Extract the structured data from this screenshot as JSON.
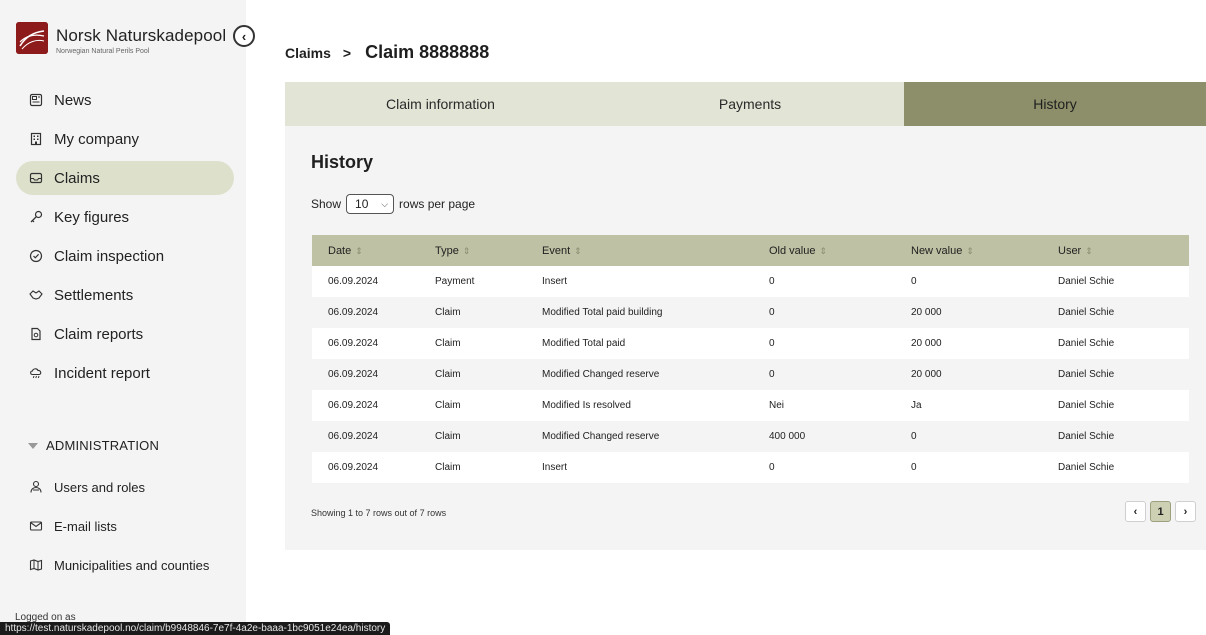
{
  "brand": {
    "title": "Norsk Naturskadepool",
    "subtitle": "Norwegian Natural Perils Pool"
  },
  "sidebar": {
    "items": [
      {
        "label": "News",
        "icon": "newspaper-icon"
      },
      {
        "label": "My company",
        "icon": "building-icon"
      },
      {
        "label": "Claims",
        "icon": "inbox-icon",
        "active": true
      },
      {
        "label": "Key figures",
        "icon": "key-icon"
      },
      {
        "label": "Claim inspection",
        "icon": "check-circle-icon"
      },
      {
        "label": "Settlements",
        "icon": "handshake-icon"
      },
      {
        "label": "Claim reports",
        "icon": "report-file-icon"
      },
      {
        "label": "Incident report",
        "icon": "storm-cloud-icon"
      }
    ],
    "admin_header": "ADMINISTRATION",
    "admin_items": [
      {
        "label": "Users and roles",
        "icon": "users-icon"
      },
      {
        "label": "E-mail lists",
        "icon": "mail-icon"
      },
      {
        "label": "Municipalities and counties",
        "icon": "map-icon"
      }
    ],
    "logged_on": "Logged on as"
  },
  "status_url": "https://test.naturskadepool.no/claim/b9948846-7e7f-4a2e-baaa-1bc9051e24ea/history",
  "breadcrumb": {
    "parent": "Claims",
    "separator": ">",
    "current": "Claim 8888888"
  },
  "tabs": [
    {
      "label": "Claim information"
    },
    {
      "label": "Payments"
    },
    {
      "label": "History",
      "active": true
    }
  ],
  "history": {
    "title": "History",
    "show_label": "Show",
    "rows_per_page": "10",
    "rows_per_page_suffix": "rows per page",
    "columns": [
      "Date",
      "Type",
      "Event",
      "Old value",
      "New value",
      "User"
    ],
    "rows": [
      [
        "06.09.2024",
        "Payment",
        "Insert",
        "0",
        "0",
        "Daniel Schie"
      ],
      [
        "06.09.2024",
        "Claim",
        "Modified Total paid building",
        "0",
        "20 000",
        "Daniel Schie"
      ],
      [
        "06.09.2024",
        "Claim",
        "Modified Total paid",
        "0",
        "20 000",
        "Daniel Schie"
      ],
      [
        "06.09.2024",
        "Claim",
        "Modified Changed reserve",
        "0",
        "20 000",
        "Daniel Schie"
      ],
      [
        "06.09.2024",
        "Claim",
        "Modified Is resolved",
        "Nei",
        "Ja",
        "Daniel Schie"
      ],
      [
        "06.09.2024",
        "Claim",
        "Modified Changed reserve",
        "400 000",
        "0",
        "Daniel Schie"
      ],
      [
        "06.09.2024",
        "Claim",
        "Insert",
        "0",
        "0",
        "Daniel Schie"
      ]
    ],
    "summary": "Showing 1 to 7 rows out of 7 rows",
    "pagination": {
      "prev": "‹",
      "current_page": "1",
      "next": "›"
    }
  },
  "colors": {
    "active_nav": "#dde1cc",
    "tab_bg": "#e2e5d6",
    "tab_active": "#8d8f6a",
    "table_header": "#bec1a3",
    "logo": "#8d1b1b"
  }
}
